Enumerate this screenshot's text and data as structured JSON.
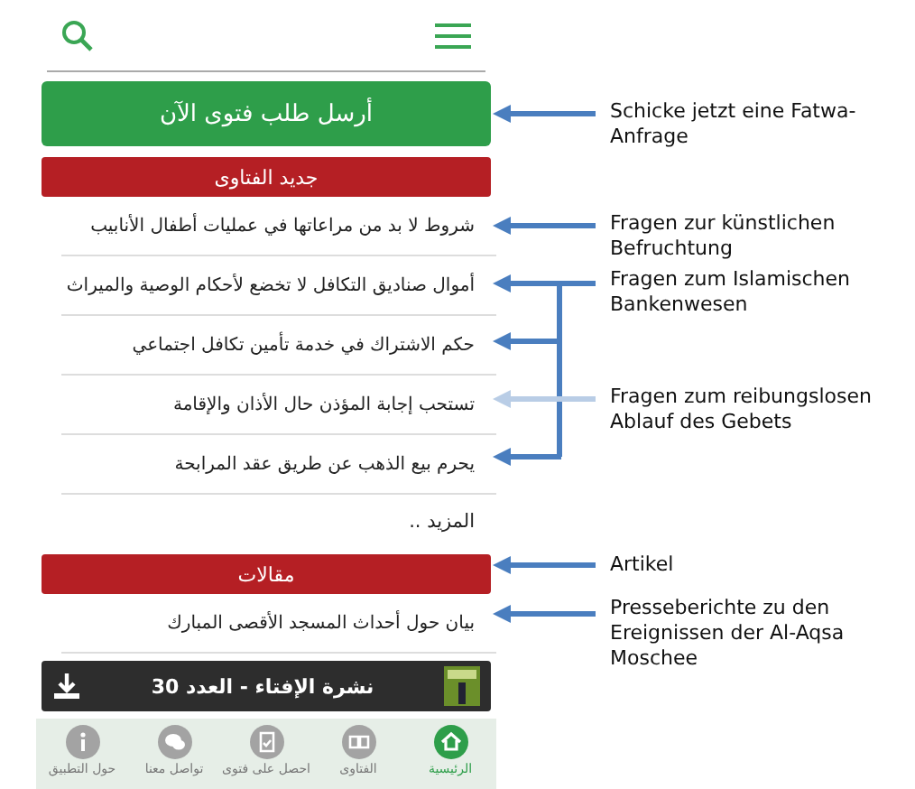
{
  "app": {
    "ask_button": "أرسل طلب فتوى الآن",
    "sections": [
      {
        "title": "جديد الفتاوى",
        "items": [
          "شروط لا بد من مراعاتها في عمليات أطفال الأنابيب",
          "أموال صناديق التكافل لا تخضع لأحكام الوصية والميراث",
          "حكم الاشتراك في خدمة تأمين تكافل اجتماعي",
          "تستحب إجابة المؤذن حال الأذان والإقامة",
          "يحرم بيع الذهب عن طريق عقد المرابحة"
        ],
        "more": "المزيد .."
      },
      {
        "title": "مقالات",
        "items": [
          "بيان حول أحداث المسجد الأقصى المبارك"
        ]
      }
    ],
    "bulletin": "نشرة الإفتاء - العدد 30",
    "nav": [
      {
        "label": "الرئيسية",
        "selected": true
      },
      {
        "label": "الفتاوى",
        "selected": false
      },
      {
        "label": "احصل على فتوى",
        "selected": false
      },
      {
        "label": "تواصل معنا",
        "selected": false
      },
      {
        "label": "حول التطبيق",
        "selected": false
      }
    ]
  },
  "annotations": [
    {
      "text": "Schicke jetzt eine Fatwa-Anfrage",
      "kind": "single"
    },
    {
      "text": "Fragen zur künstlichen Befruchtung",
      "kind": "single"
    },
    {
      "text": "Fragen zum Islamischen Bankenwesen",
      "kind": "bracket"
    },
    {
      "text": "Fragen zum reibungslosen Ablauf des Gebets",
      "kind": "faint"
    },
    {
      "text": "Artikel",
      "kind": "single"
    },
    {
      "text": "Presseberichte zu den Ereignissen der Al-Aqsa Moschee",
      "kind": "single"
    }
  ]
}
